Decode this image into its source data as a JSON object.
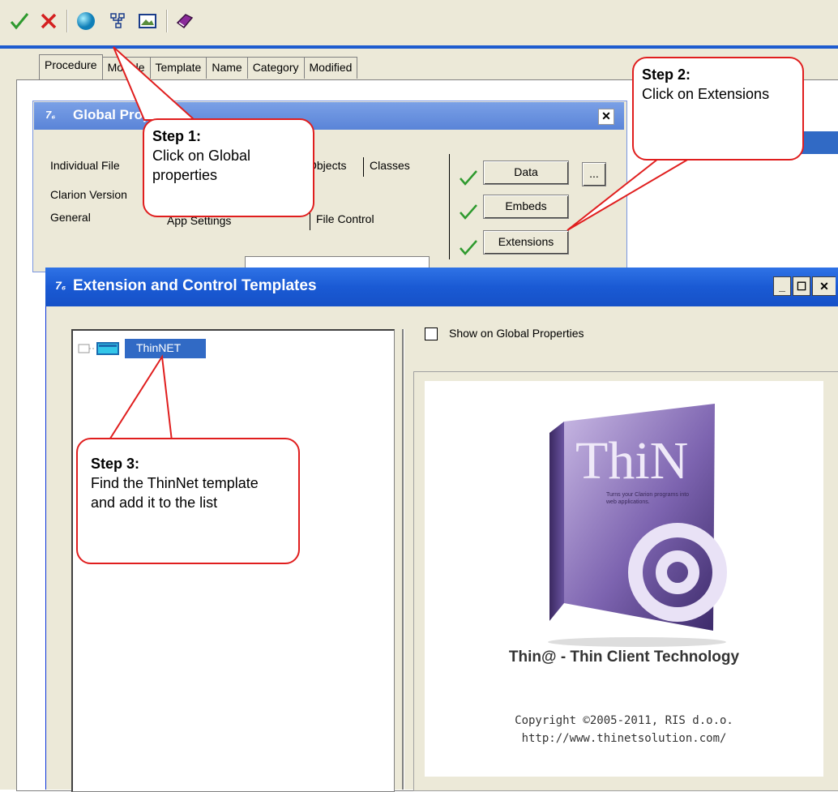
{
  "toolbar": {
    "buttons": [
      "check-icon",
      "cross-icon",
      "globe-icon",
      "tree-icon",
      "image-icon",
      "book-icon"
    ]
  },
  "ide_tabs": [
    {
      "label": "Procedure"
    },
    {
      "label": "Module"
    },
    {
      "label": "Template"
    },
    {
      "label": "Name"
    },
    {
      "label": "Category"
    },
    {
      "label": "Modified"
    }
  ],
  "global_props": {
    "title": "Global Properties",
    "tabs_row1": [
      "Individual File",
      "Objects",
      "Classes"
    ],
    "tabs_row2": [
      "Clarion Version"
    ],
    "tabs_row3": [
      "General",
      "App Settings",
      "File Control"
    ],
    "buttons": {
      "data": "Data",
      "ellipsis": "...",
      "embeds": "Embeds",
      "extensions": "Extensions"
    }
  },
  "ext_window": {
    "title": "Extension and Control Templates",
    "tree_item": "ThinNET",
    "checkbox_label": "Show on Global Properties",
    "product_caption": "Thin@ - Thin Client Technology",
    "copyright": "Copyright ©2005-2011, RIS d.o.o.",
    "url": "http://www.thinetsolution.com/",
    "box_logo": "ThiN",
    "box_tagline": "Turns your Clarion programs into web applications."
  },
  "callouts": {
    "step1": {
      "heading": "Step 1:",
      "text": "Click on Global properties"
    },
    "step2": {
      "heading": "Step 2:",
      "text": "Click on Extensions"
    },
    "step3": {
      "heading": "Step 3:",
      "text": "Find the ThinNet template and add it to the list"
    }
  },
  "colors": {
    "accent": "#316ac5",
    "callout_border": "#e01e1e",
    "check": "#2e9a2e"
  }
}
